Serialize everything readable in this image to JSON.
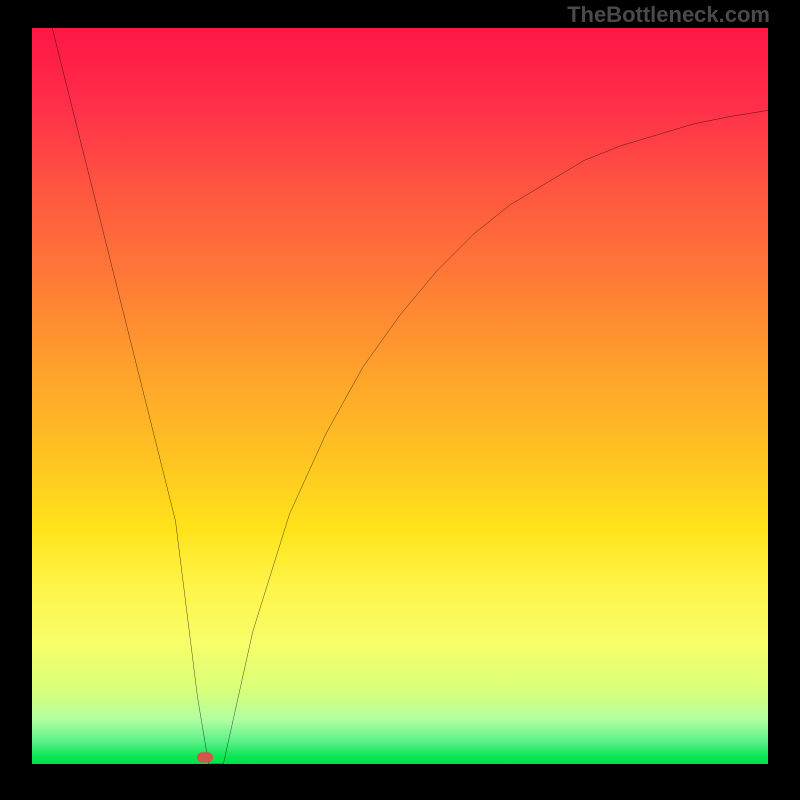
{
  "watermark": "TheBottleneck.com",
  "chart_data": {
    "type": "line",
    "title": "",
    "xlabel": "",
    "ylabel": "",
    "xlim": [
      0,
      100
    ],
    "ylim": [
      0,
      100
    ],
    "grid": false,
    "legend": false,
    "series": [
      {
        "name": "curve",
        "color": "#000000",
        "x": [
          2.5,
          5,
          10,
          15,
          18,
          19.5,
          21,
          22.5,
          24,
          25,
          26,
          30,
          35,
          40,
          45,
          50,
          55,
          60,
          65,
          70,
          75,
          80,
          85,
          90,
          95,
          100
        ],
        "y": [
          101,
          91,
          71,
          51,
          39,
          33,
          21,
          9,
          0,
          0,
          0,
          18,
          34,
          45,
          54,
          61,
          67,
          72,
          76,
          79,
          82,
          84,
          85.5,
          87,
          88,
          88.8
        ]
      }
    ],
    "marker": {
      "x_percent": 23.5,
      "y_percent": 0.5,
      "color": "#d4554a",
      "shape": "rounded-rect"
    }
  }
}
